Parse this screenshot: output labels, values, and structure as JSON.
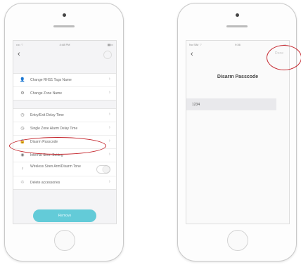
{
  "left_phone": {
    "screen": {
      "status": {
        "left": "•••• ⌔",
        "time": "4:48 PM",
        "right": "▮▮▭"
      },
      "menu_group_1": [
        {
          "label": "Change RHS1 Tags Name",
          "icon": "person-icon",
          "glyph": "👤"
        },
        {
          "label": "Change Zone Name",
          "icon": "gear-icon",
          "glyph": "⚙"
        }
      ],
      "menu_group_2": [
        {
          "label": "Entry/Exit Delay Time",
          "icon": "clock-icon",
          "glyph": "◷"
        },
        {
          "label": "Single Zone Alarm Delay Time",
          "icon": "clock-icon",
          "glyph": "◷"
        },
        {
          "label": "Disarm Passcode",
          "icon": "lock-icon",
          "glyph": "🔒"
        },
        {
          "label": "Internal Siren Setting",
          "icon": "siren-icon",
          "glyph": "◉"
        },
        {
          "label": "Wireless Siren Arm/Disarm Tone",
          "icon": "siren-icon",
          "glyph": "♪"
        },
        {
          "label": "Delete accessories",
          "icon": "trash-icon",
          "glyph": "♲"
        }
      ],
      "action_button": "Remove"
    }
  },
  "right_phone": {
    "screen": {
      "status": {
        "left": "No SIM ⌔",
        "time": "9:36",
        "right": "▭"
      },
      "done_label": "Done",
      "title": "Disarm Passcode",
      "passcode_value": "1234"
    }
  },
  "colors": {
    "accent": "#63cbd8",
    "highlight": "#c4242b"
  }
}
